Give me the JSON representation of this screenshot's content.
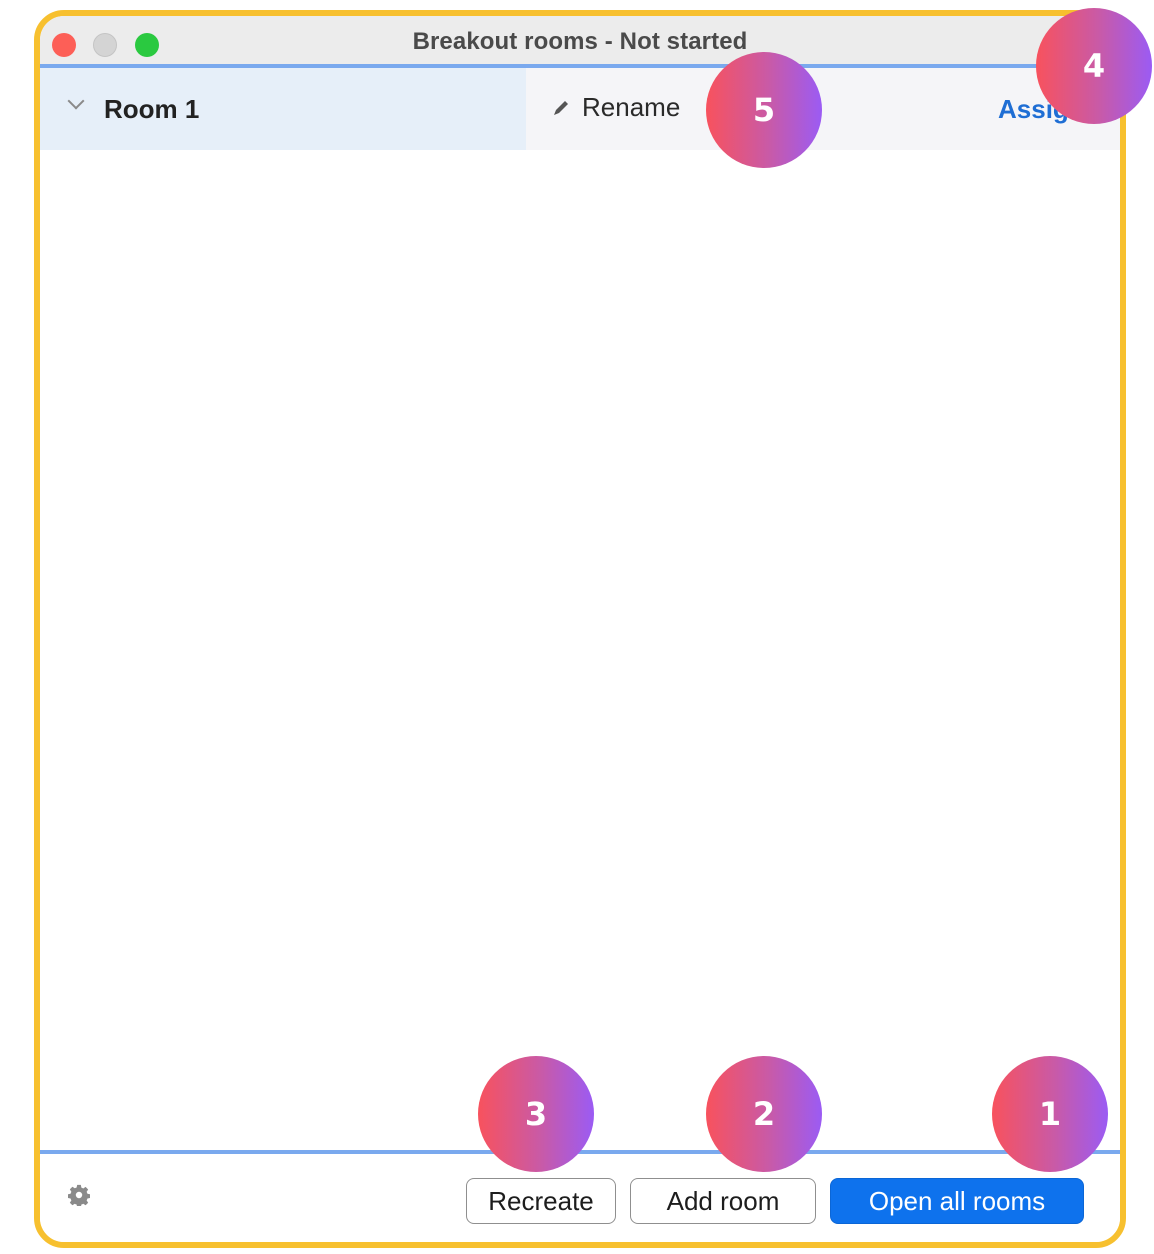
{
  "window": {
    "title": "Breakout rooms - Not started"
  },
  "room": {
    "name": "Room 1",
    "rename_label": "Rename",
    "assign_label": "Assig"
  },
  "footer": {
    "recreate_label": "Recreate",
    "add_room_label": "Add room",
    "open_all_label": "Open all rooms"
  },
  "badges": [
    "1",
    "2",
    "3",
    "4",
    "5"
  ],
  "icons": {
    "chevron": "chevron-down-icon",
    "pencil": "pencil-icon",
    "settings": "gear-icon"
  },
  "colors": {
    "frame_border": "#f7c02f",
    "primary_button": "#0e72ed",
    "assign_link": "#1f6ed4",
    "divider": "#7aa9ee",
    "badge_gradient_start": "#f8525d",
    "badge_gradient_end": "#9b5bf4"
  }
}
